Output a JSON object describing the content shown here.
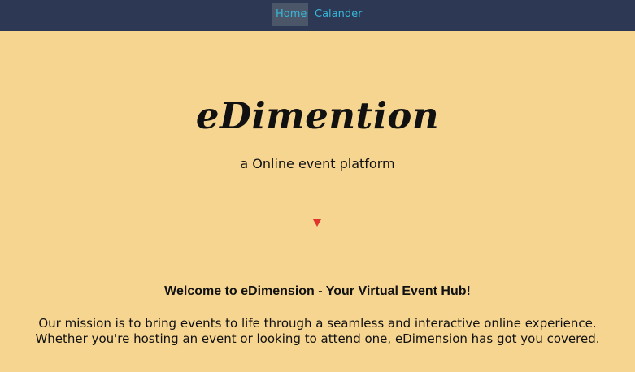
{
  "nav": {
    "items": [
      {
        "label": "Home"
      },
      {
        "label": "Calander"
      }
    ]
  },
  "hero": {
    "brand": "eDimention",
    "tagline": "a Online event platform",
    "scroll_indicator_icon": "triangle-down-icon",
    "arrow_color": "#e0352b"
  },
  "intro": {
    "heading": "Welcome to eDimension - Your Virtual Event Hub!",
    "paragraph": "Our mission is to bring events to life through a seamless and interactive online experience. Whether you're hosting an event or looking to attend one, eDimension has got you covered."
  },
  "colors": {
    "navbar_bg": "#2d3854",
    "nav_link": "#37b6d8",
    "nav_active_bg": "#4b5669",
    "page_bg": "#f6d590"
  }
}
